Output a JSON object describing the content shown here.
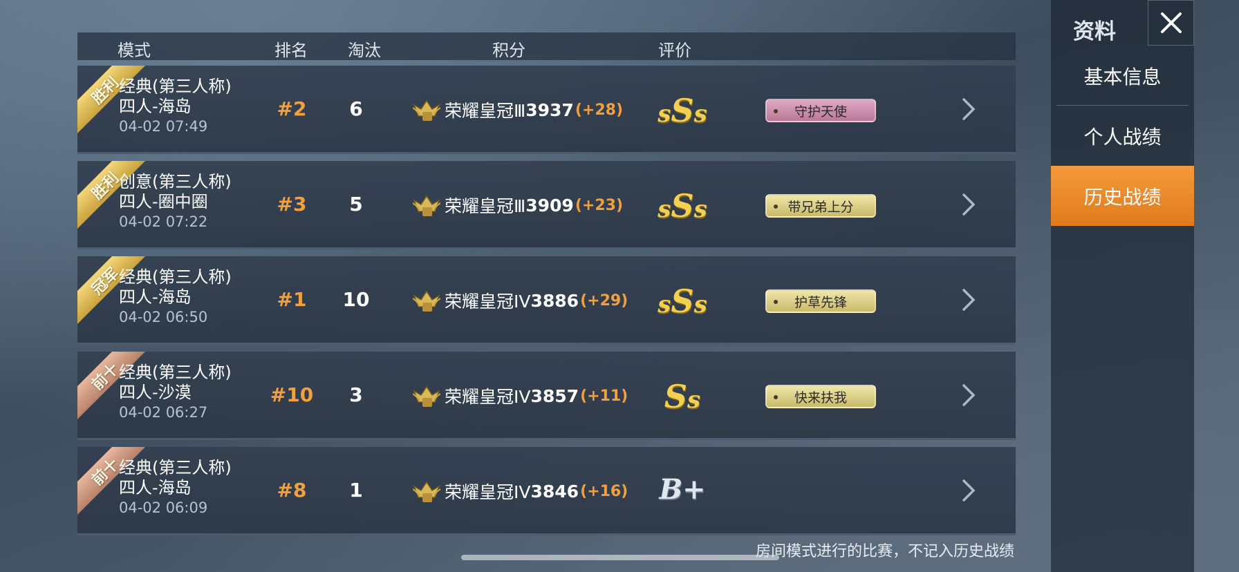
{
  "table": {
    "headers": [
      "模式",
      "排名",
      "淘汰",
      "积分",
      "评价"
    ],
    "rows": [
      {
        "ribbon": "胜利",
        "ribbon_style": "gold",
        "mode_line1": "经典(第三人称)",
        "mode_line2": "四人-海岛",
        "datetime": "04-02 07:49",
        "rank": "#2",
        "kills": "6",
        "tier_icon": "crown-tier-3-icon",
        "tier_name": "荣耀皇冠Ⅲ",
        "points": "3937",
        "delta": "(+28)",
        "grade": "SSS",
        "tag": "守护天使",
        "tag_style": "pink"
      },
      {
        "ribbon": "胜利",
        "ribbon_style": "gold",
        "mode_line1": "创意(第三人称)",
        "mode_line2": "四人-圈中圈",
        "datetime": "04-02 07:22",
        "rank": "#3",
        "kills": "5",
        "tier_icon": "crown-tier-3-icon",
        "tier_name": "荣耀皇冠Ⅲ",
        "points": "3909",
        "delta": "(+23)",
        "grade": "SSS",
        "tag": "带兄弟上分",
        "tag_style": "gold"
      },
      {
        "ribbon": "冠军",
        "ribbon_style": "gold",
        "mode_line1": "经典(第三人称)",
        "mode_line2": "四人-海岛",
        "datetime": "04-02 06:50",
        "rank": "#1",
        "kills": "10",
        "tier_icon": "crown-tier-4-icon",
        "tier_name": "荣耀皇冠IV",
        "points": "3886",
        "delta": "(+29)",
        "grade": "SSS",
        "tag": "护草先锋",
        "tag_style": "gold"
      },
      {
        "ribbon": "前十",
        "ribbon_style": "bronze",
        "mode_line1": "经典(第三人称)",
        "mode_line2": "四人-沙漠",
        "datetime": "04-02 06:27",
        "rank": "#10",
        "kills": "3",
        "tier_icon": "crown-tier-4-icon",
        "tier_name": "荣耀皇冠IV",
        "points": "3857",
        "delta": "(+11)",
        "grade": "SS",
        "tag": "快来扶我",
        "tag_style": "gold"
      },
      {
        "ribbon": "前十",
        "ribbon_style": "bronze",
        "mode_line1": "经典(第三人称)",
        "mode_line2": "四人-海岛",
        "datetime": "04-02 06:09",
        "rank": "#8",
        "kills": "1",
        "tier_icon": "crown-tier-4-icon",
        "tier_name": "荣耀皇冠IV",
        "points": "3846",
        "delta": "(+16)",
        "grade": "B+",
        "tag": "",
        "tag_style": ""
      }
    ]
  },
  "footer_note": "房间模式进行的比赛，不记入历史战绩",
  "panel": {
    "title": "资料",
    "close_icon": "close-icon",
    "nav": [
      {
        "label": "基本信息",
        "active": false
      },
      {
        "label": "个人战绩",
        "active": false
      },
      {
        "label": "历史战绩",
        "active": true
      }
    ]
  },
  "colors": {
    "accent_orange": "#f0a040",
    "active_tab": "#e88a2a",
    "grade_gold": "#f3cf52"
  }
}
